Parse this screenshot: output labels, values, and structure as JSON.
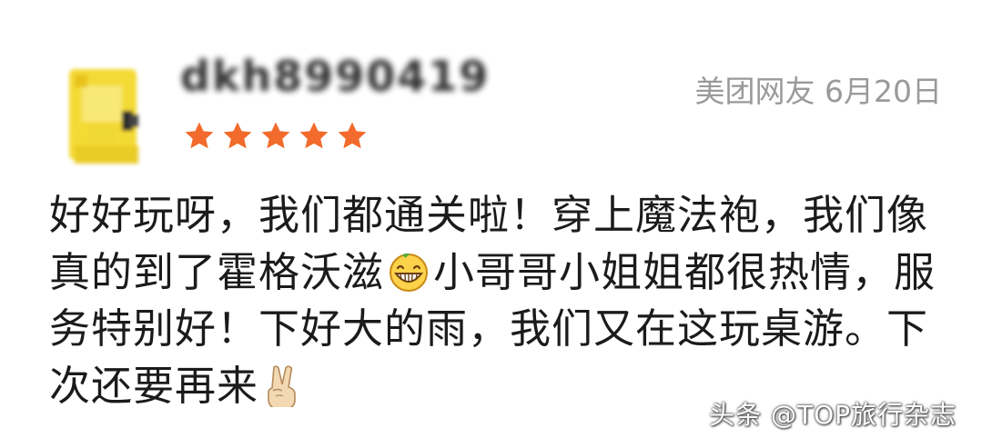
{
  "review": {
    "username": "dkh8990419",
    "source": "美团网友",
    "date": "6月20日",
    "rating": 5,
    "line1": "好好玩呀，我们都通关啦！穿上魔法袍，我们像",
    "line2_before_emoji": "真的到了霍格沃滋",
    "line2_after_emoji": "小哥哥小姐姐都很热情，服",
    "line3": "务特别好！下好大的雨，我们又在这玩桌游。下",
    "line4": "次还要再来",
    "emoji_1": "grinning-face-icon",
    "emoji_2": "victory-hand-icon"
  },
  "watermark": "头条 @TOP旅行杂志",
  "colors": {
    "star": "#f26b2c",
    "meta_text": "#9a9a9a",
    "avatar": "#f5dd3a"
  }
}
